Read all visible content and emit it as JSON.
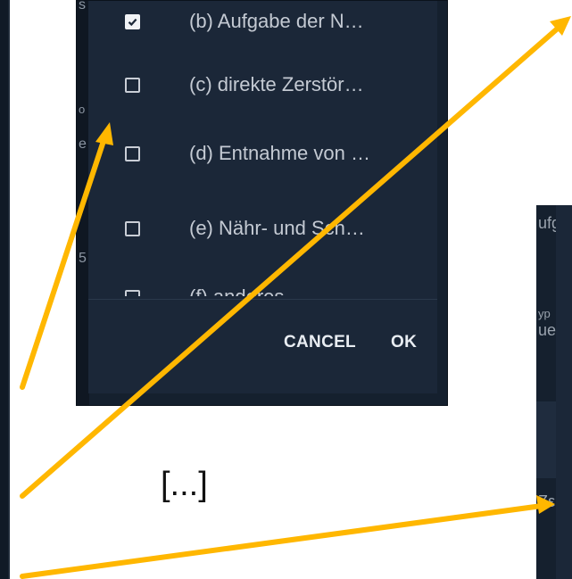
{
  "dialog": {
    "options": [
      {
        "label": "(b) Aufgabe der N…",
        "checked": true
      },
      {
        "label": "(c) direkte Zerstör…",
        "checked": false
      },
      {
        "label": "(d) Entnahme von …",
        "checked": false
      },
      {
        "label": "(e) Nähr- und Sch…",
        "checked": false
      },
      {
        "label": "(f) anderes",
        "checked": false
      }
    ],
    "cancel_label": "CANCEL",
    "ok_label": "OK"
  },
  "background_fragments": {
    "left": [
      "s",
      "o",
      "e",
      "5"
    ],
    "right": [
      "ufg",
      "yp",
      "ue",
      "Zε"
    ]
  },
  "separator_text": "[...]",
  "colors": {
    "arrow": "#ffb700",
    "dialog_bg": "#1b2738",
    "text": "#c4cad3"
  }
}
